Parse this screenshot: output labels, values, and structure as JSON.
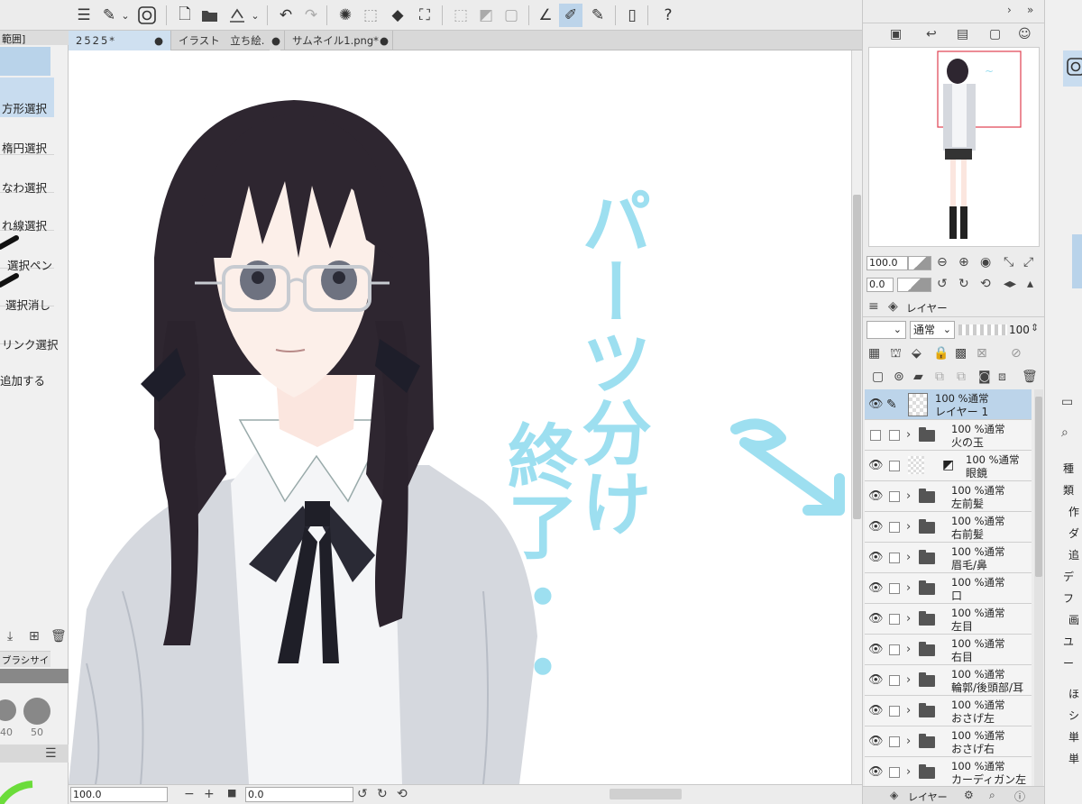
{
  "toolbar": {
    "icons": [
      "menu-icon",
      "pen-settings-icon",
      "chevron-down-icon",
      "clip-studio-icon",
      "new-file-icon",
      "open-folder-icon",
      "save-icon",
      "chevron-down-icon",
      "undo-icon",
      "redo-icon",
      "loading-icon",
      "select-all-icon",
      "fill-icon",
      "transform-icon",
      "deselect-icon",
      "invert-selection-icon",
      "border-icon",
      "ruler-icon",
      "brush-icon",
      "pen-icon",
      "phone-icon",
      "help-icon"
    ]
  },
  "left_panel": {
    "header_label": "範囲]",
    "tools": [
      "方形選択",
      "楕円選択",
      "なわ選択",
      "れ線選択",
      "選択ペン",
      "選択消し",
      "リンク選択",
      "追加する"
    ],
    "brush_size_label": "ブラシサイズ",
    "brush_sizes": [
      "40",
      "50"
    ]
  },
  "doc_tabs": [
    {
      "label": "2525*",
      "active": true
    },
    {
      "label": "イラスト　立ち絵.",
      "active": false
    },
    {
      "label": "サムネイル1.png*",
      "active": false
    }
  ],
  "canvas": {
    "handwritten_text": [
      "パーツ分け",
      "終了・・"
    ],
    "handwriting_color": "#9ddff0"
  },
  "status": {
    "zoom": "100.0",
    "angle": "0.0"
  },
  "navigator": {
    "zoom": "100.0",
    "angle": "0.0"
  },
  "layer_panel": {
    "tab_label": "レイヤー",
    "blend_mode": "通常",
    "opacity": "100",
    "bottom_tab_label": "レイヤー",
    "layers": [
      {
        "line1": "100 %通常",
        "line2": "レイヤー 1",
        "type": "raster",
        "visible": true,
        "selected": true
      },
      {
        "line1": "100 %通常",
        "line2": "火の玉",
        "type": "folder",
        "visible": false,
        "selected": false
      },
      {
        "line1": "100 %通常",
        "line2": "眼鏡",
        "type": "vector",
        "visible": true,
        "selected": false
      },
      {
        "line1": "100 %通常",
        "line2": "左前髪",
        "type": "folder",
        "visible": true,
        "selected": false
      },
      {
        "line1": "100 %通常",
        "line2": "右前髪",
        "type": "folder",
        "visible": true,
        "selected": false
      },
      {
        "line1": "100 %通常",
        "line2": "眉毛/鼻",
        "type": "folder",
        "visible": true,
        "selected": false
      },
      {
        "line1": "100 %通常",
        "line2": "口",
        "type": "folder",
        "visible": true,
        "selected": false
      },
      {
        "line1": "100 %通常",
        "line2": "左目",
        "type": "folder",
        "visible": true,
        "selected": false
      },
      {
        "line1": "100 %通常",
        "line2": "右目",
        "type": "folder",
        "visible": true,
        "selected": false
      },
      {
        "line1": "100 %通常",
        "line2": "輪郭/後頭部/耳",
        "type": "folder",
        "visible": true,
        "selected": false
      },
      {
        "line1": "100 %通常",
        "line2": "おさげ左",
        "type": "folder",
        "visible": true,
        "selected": false
      },
      {
        "line1": "100 %通常",
        "line2": "おさげ右",
        "type": "folder",
        "visible": true,
        "selected": false
      },
      {
        "line1": "100 %通常",
        "line2": "カーディガン左",
        "type": "folder",
        "visible": true,
        "selected": false
      }
    ]
  },
  "far_right": {
    "labels": [
      "種類",
      "作",
      "ダ",
      "追",
      "デフ",
      "画",
      "ユー",
      "ほ",
      "シ",
      "単",
      "単"
    ]
  }
}
